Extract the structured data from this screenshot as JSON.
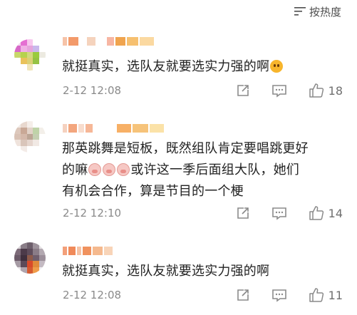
{
  "sort": {
    "label": "按热度",
    "icon": "sort-icon"
  },
  "comments": [
    {
      "text_parts": [
        "就挺真实，选队友就要选实力强的啊"
      ],
      "emoji_after": "flushed-face",
      "timestamp": "2-12 12:08",
      "likes": "18"
    },
    {
      "text_line1": "那英跳舞是短板，既然组队肯定要唱跳更好",
      "text_line2_pre": "的嘛",
      "text_line2_post": "或许这一季后面组大队，她们",
      "text_line3": "有机会合作，算是节目的一个梗",
      "emojis": [
        "pig-face",
        "pig-face",
        "pig-face"
      ],
      "timestamp": "2-12 12:10",
      "likes": "14"
    },
    {
      "text_parts": [
        "就挺真实，选队友就要选实力强的啊"
      ],
      "timestamp": "2-12 12:08",
      "likes": "11"
    }
  ],
  "icons": {
    "repost": "repost-icon",
    "comment": "comment-icon",
    "like": "thumbs-up-icon"
  },
  "colors": {
    "text": "#222222",
    "meta": "#8a8a8a",
    "username_blur": "#f2a03d"
  }
}
